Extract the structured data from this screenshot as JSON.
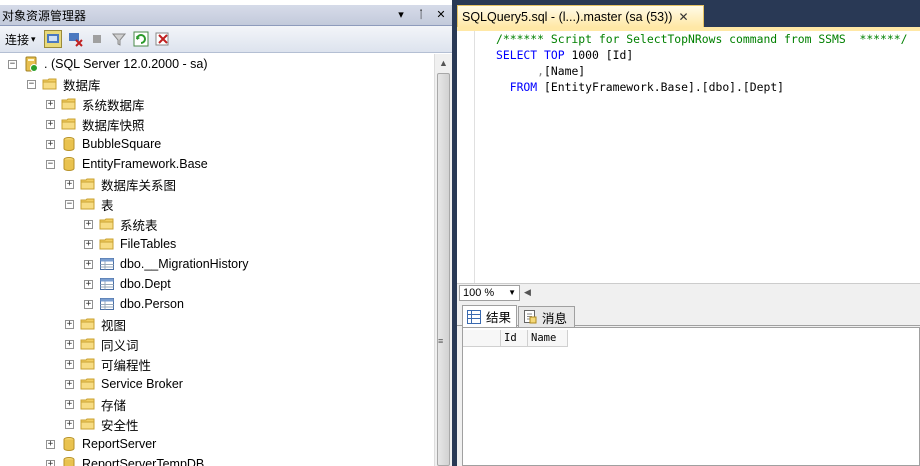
{
  "object_explorer": {
    "title": "对象资源管理器",
    "title_buttons": [
      "▾",
      "ᛙ",
      "✕"
    ],
    "toolbar": {
      "connect_label": "连接",
      "connect_arrow": "▾"
    },
    "tree": [
      {
        "label": ". (SQL Server 12.0.2000 - sa)",
        "level": 0,
        "expander": "−",
        "icon": "server-icon"
      },
      {
        "label": "数据库",
        "level": 1,
        "expander": "−",
        "icon": "folder-icon"
      },
      {
        "label": "系统数据库",
        "level": 2,
        "expander": "+",
        "icon": "folder-icon"
      },
      {
        "label": "数据库快照",
        "level": 2,
        "expander": "+",
        "icon": "folder-icon"
      },
      {
        "label": "BubbleSquare",
        "level": 2,
        "expander": "+",
        "icon": "database-icon"
      },
      {
        "label": "EntityFramework.Base",
        "level": 2,
        "expander": "−",
        "icon": "database-icon"
      },
      {
        "label": "数据库关系图",
        "level": 3,
        "expander": "+",
        "icon": "folder-icon"
      },
      {
        "label": "表",
        "level": 3,
        "expander": "−",
        "icon": "folder-icon"
      },
      {
        "label": "系统表",
        "level": 4,
        "expander": "+",
        "icon": "folder-icon"
      },
      {
        "label": "FileTables",
        "level": 4,
        "expander": "+",
        "icon": "folder-icon"
      },
      {
        "label": "dbo.__MigrationHistory",
        "level": 4,
        "expander": "+",
        "icon": "table-icon"
      },
      {
        "label": "dbo.Dept",
        "level": 4,
        "expander": "+",
        "icon": "table-icon"
      },
      {
        "label": "dbo.Person",
        "level": 4,
        "expander": "+",
        "icon": "table-icon"
      },
      {
        "label": "视图",
        "level": 3,
        "expander": "+",
        "icon": "folder-icon"
      },
      {
        "label": "同义词",
        "level": 3,
        "expander": "+",
        "icon": "folder-icon"
      },
      {
        "label": "可编程性",
        "level": 3,
        "expander": "+",
        "icon": "folder-icon"
      },
      {
        "label": "Service Broker",
        "level": 3,
        "expander": "+",
        "icon": "folder-icon"
      },
      {
        "label": "存储",
        "level": 3,
        "expander": "+",
        "icon": "folder-icon"
      },
      {
        "label": "安全性",
        "level": 3,
        "expander": "+",
        "icon": "folder-icon"
      },
      {
        "label": "ReportServer",
        "level": 2,
        "expander": "+",
        "icon": "database-icon"
      },
      {
        "label": "ReportServerTempDB",
        "level": 2,
        "expander": "+",
        "icon": "database-icon"
      }
    ]
  },
  "editor": {
    "tab_label": "SQLQuery5.sql - (l...).master (sa (53))",
    "tab_close": "✕",
    "code": {
      "comment": "/****** Script for SelectTopNRows command from SSMS  ******/",
      "select_kw": "SELECT",
      "top_kw": "TOP",
      "top_value": "1000",
      "col1": "[Id]",
      "comma": ",",
      "col2": "[Name]",
      "from_kw": "FROM",
      "table": "[EntityFramework.Base].[dbo].[Dept]"
    },
    "zoom": "100 %"
  },
  "results": {
    "tab_results": "结果",
    "tab_messages": "消息",
    "columns": [
      "Id",
      "Name"
    ]
  },
  "colors": {
    "background": "#293955",
    "active_tab": "#ffe8a6",
    "keyword": "#0000ff",
    "comment": "#008000"
  }
}
